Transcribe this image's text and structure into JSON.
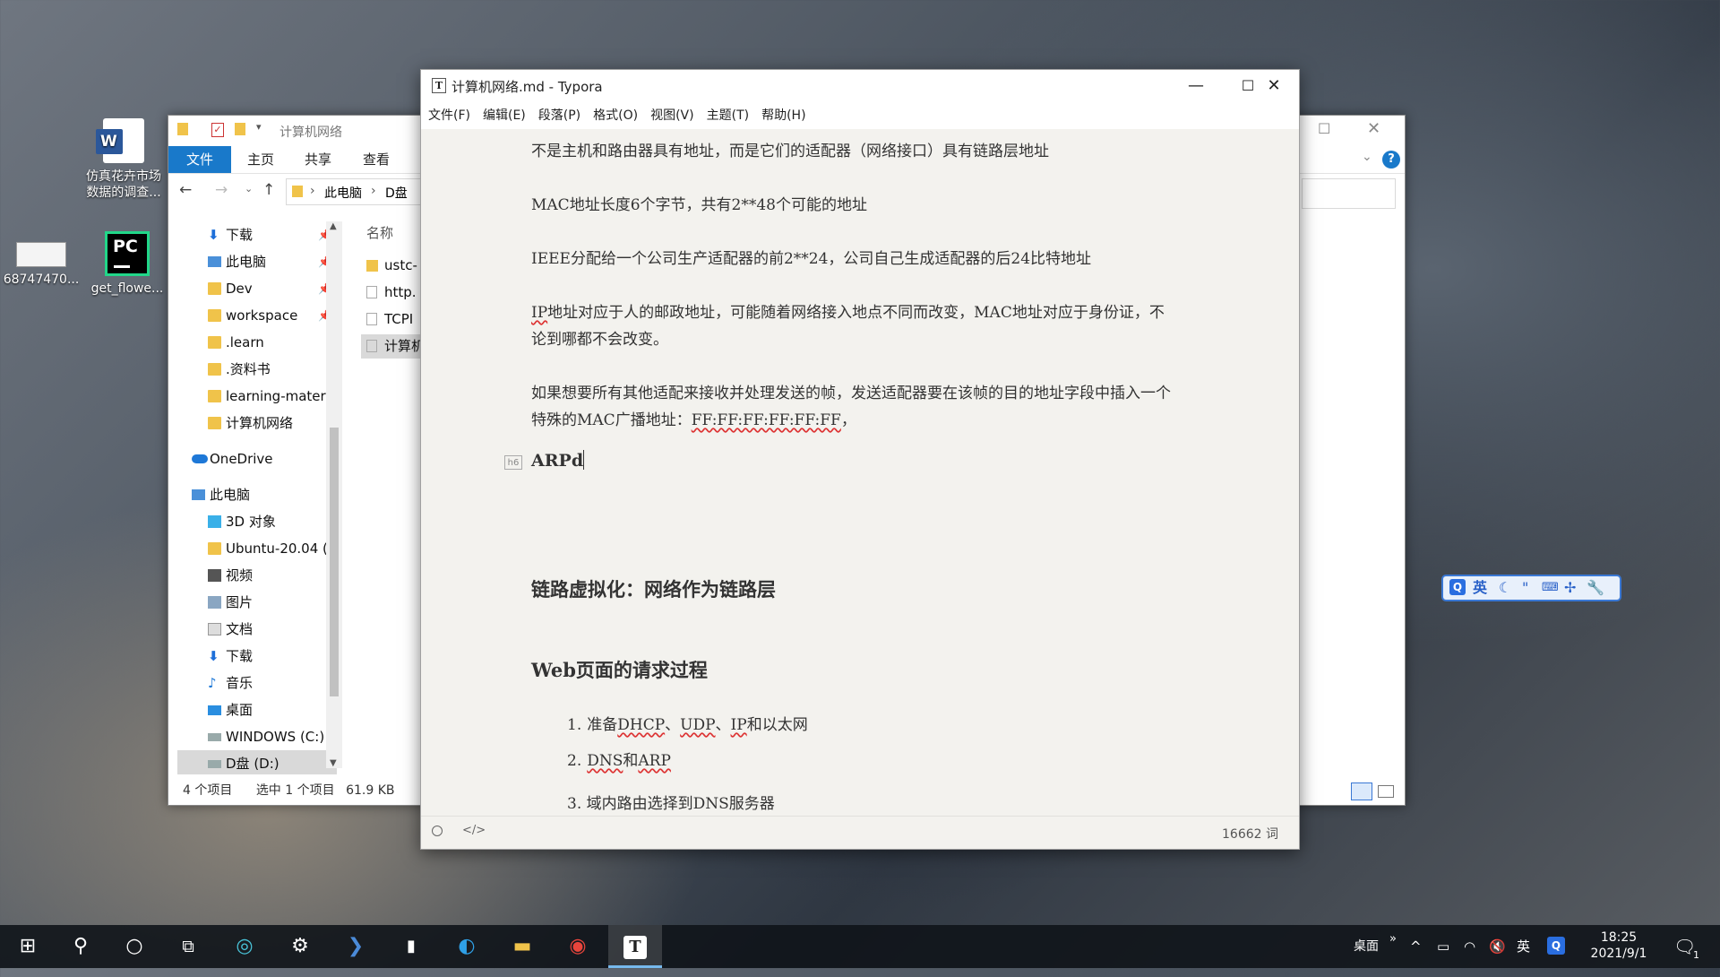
{
  "desktop": {
    "icons": [
      {
        "label": "仿真花卉市场数据的调查...",
        "icon": "word-doc-icon"
      },
      {
        "label": "68747470...",
        "icon": "image-file-icon"
      },
      {
        "label": "get_flowe...",
        "icon": "pycharm-icon"
      }
    ]
  },
  "explorer": {
    "title": "计算机网络",
    "ribbon_tabs": [
      "文件",
      "主页",
      "共享",
      "查看"
    ],
    "breadcrumb": [
      "此电脑",
      "D盘"
    ],
    "nav_quick": [
      {
        "label": "下载",
        "icon": "download-icon",
        "pinned": true
      },
      {
        "label": "此电脑",
        "icon": "pc-icon",
        "pinned": true
      },
      {
        "label": "Dev",
        "icon": "folder-icon",
        "pinned": true
      },
      {
        "label": "workspace",
        "icon": "folder-icon",
        "pinned": true
      },
      {
        "label": ".learn",
        "icon": "folder-icon",
        "pinned": false
      },
      {
        "label": ".资料书",
        "icon": "folder-icon",
        "pinned": false
      },
      {
        "label": "learning-mater",
        "icon": "folder-icon",
        "pinned": false
      },
      {
        "label": "计算机网络",
        "icon": "folder-icon",
        "pinned": false
      }
    ],
    "nav_onedrive": "OneDrive",
    "nav_pc": [
      {
        "label": "此电脑",
        "icon": "pc-icon"
      },
      {
        "label": "3D 对象",
        "icon": "cube-icon"
      },
      {
        "label": "Ubuntu-20.04 (",
        "icon": "folder-icon"
      },
      {
        "label": "视频",
        "icon": "video-icon"
      },
      {
        "label": "图片",
        "icon": "picture-icon"
      },
      {
        "label": "文档",
        "icon": "document-icon"
      },
      {
        "label": "下载",
        "icon": "download-icon"
      },
      {
        "label": "音乐",
        "icon": "music-icon"
      },
      {
        "label": "桌面",
        "icon": "desktop-icon"
      },
      {
        "label": "WINDOWS (C:)",
        "icon": "drive-icon"
      },
      {
        "label": "D盘 (D:)",
        "icon": "drive-icon"
      }
    ],
    "column_name": "名称",
    "files": [
      {
        "name": "ustc-",
        "icon": "folder-icon"
      },
      {
        "name": "http.",
        "icon": "markdown-file-icon"
      },
      {
        "name": "TCPI",
        "icon": "markdown-file-icon"
      },
      {
        "name": "计算机",
        "icon": "markdown-file-icon"
      }
    ],
    "status_count": "4 个项目",
    "status_selected": "选中 1 个项目",
    "status_size": "61.9 KB"
  },
  "typora": {
    "title": "计算机网络.md - Typora",
    "menu": [
      "文件(F)",
      "编辑(E)",
      "段落(P)",
      "格式(O)",
      "视图(V)",
      "主题(T)",
      "帮助(H)"
    ],
    "p1": "不是主机和路由器具有地址，而是它们的适配器（网络接口）具有链路层地址",
    "p2": "MAC地址长度6个字节，共有2**48个可能的地址",
    "p3": "IEEE分配给一个公司生产适配器的前2**24，公司自己生成适配器的后24比特地址",
    "p4_a": "IP",
    "p4_b": "地址对应于人的邮政地址，可能随着网络接入地点不同而改变，MAC地址对应于身份证，不论到哪都不会改变。",
    "p5_a": "如果想要所有其他适配来接收并处理发送的帧，发送适配器要在该帧的目的地址字段中插入一个特殊的MAC广播地址：",
    "p5_b": "FF:FF:FF:FF:FF:FF",
    "p5_c": "，",
    "h6_tag": "h6",
    "h_arp": "ARPd",
    "h_link": "链路虚拟化：网络作为链路层",
    "h_web": "Web页面的请求过程",
    "list": {
      "i1_num": "1.",
      "i1_a": "准备",
      "i1_b": "DHCP",
      "i1_c": "、",
      "i1_d": "UDP",
      "i1_e": "、",
      "i1_f": "IP",
      "i1_g": "和以太网",
      "i2_num": "2.",
      "i2_a": "DNS",
      "i2_b": "和",
      "i2_c": "ARP",
      "i3_partial": "3.  域内路由选择到DNS服务器"
    },
    "word_count": "16662 词"
  },
  "ime": {
    "lang": "英"
  },
  "taskbar": {
    "tray_desktop": "桌面",
    "tray_lang": "英",
    "time": "18:25",
    "date": "2021/9/1",
    "notification_count": "1"
  }
}
